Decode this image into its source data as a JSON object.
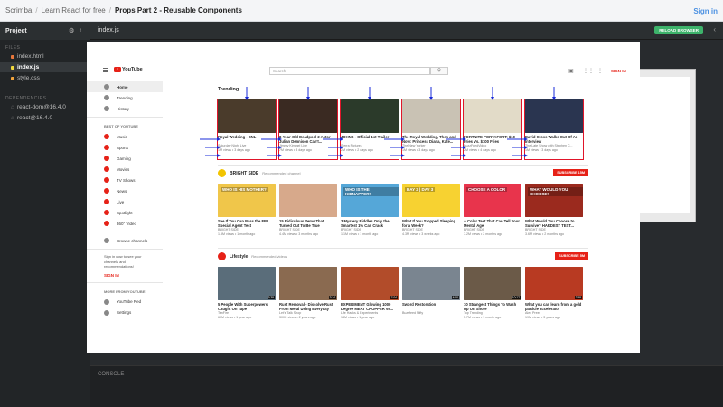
{
  "topbar": {
    "crumbs": [
      "Scrimba",
      "Learn React for free",
      "Props Part 2 - Reusable Components"
    ],
    "signin": "Sign in"
  },
  "sidebar": {
    "header": "Project",
    "files_label": "FILES",
    "files": [
      {
        "name": "index.html",
        "color": "#e8773b"
      },
      {
        "name": "index.js",
        "color": "#f1d83d",
        "active": true
      },
      {
        "name": "style.css",
        "color": "#f0a23b"
      }
    ],
    "deps_label": "DEPENDENCIES",
    "deps": [
      "react-dom@16.4.0",
      "react@16.4.0"
    ]
  },
  "editor": {
    "tab": "index.js",
    "reload": "RELOAD BROWSER",
    "console": "CONSOLE"
  },
  "yt": {
    "logo": "YouTube",
    "search_placeholder": "Search",
    "signin": "SIGN IN",
    "side": {
      "main": [
        "Home",
        "Trending",
        "History"
      ],
      "best_label": "BEST OF YOUTUBE",
      "best": [
        "Music",
        "Sports",
        "Gaming",
        "Movies",
        "TV Shows",
        "News",
        "Live",
        "Spotlight",
        "360° Video"
      ],
      "browse": "Browse channels",
      "note": "Sign in now to see your channels and recommendations!",
      "signin": "SIGN IN",
      "more_label": "MORE FROM YOUTUBE",
      "more": [
        "YouTube Red",
        "Settings"
      ]
    },
    "trending": {
      "title": "Trending",
      "cards": [
        {
          "title": "Royal Wedding - SNL",
          "channel": "Saturday Night Live",
          "meta": "1M views • 3 days ago",
          "bg": "#4a3b2b"
        },
        {
          "title": "8-Year-Old Deadpool 2 Actor Julian Dennison Can't...",
          "channel": "Jimmy Kimmel Live",
          "meta": "7M views • 3 days ago",
          "bg": "#3a2a22"
        },
        {
          "title": "JOHNS - Official 1st Trailer",
          "channel": "Sierra Pictures",
          "meta": "2M views • 2 days ago",
          "bg": "#2b3a2a"
        },
        {
          "title": "The Royal Wedding, Then and Now: Princess Diana, Kate...",
          "channel": "The New Yorker",
          "meta": "1M views • 3 days ago",
          "bg": "#c9c2b4"
        },
        {
          "title": "FORTNITE PORTAFORT: $10 Fries Vs. $100 Fries",
          "channel": "BuzzFeedVideo",
          "meta": "2M views • 4 days ago",
          "bg": "#e2dbc8"
        },
        {
          "title": "David Cross Walks Out Of An Interview",
          "channel": "The Late Show with Stephen C...",
          "meta": "1M views • 3 days ago",
          "bg": "#2a3550"
        }
      ]
    },
    "bright": {
      "name": "BRIGHT SIDE",
      "sub": "Recommended channel",
      "subscribe": "SUBSCRIBE 15M",
      "cards": [
        {
          "title": "See If You Can Pass the FBI Special Agent Test",
          "channel": "BRIGHT SIDE",
          "meta": "1.5M views • 1 month ago",
          "bg": "#f0c64a",
          "label": "WHO IS HIS MOTHER?"
        },
        {
          "title": "15 Ridiculous Items That Turned Out To Be True",
          "channel": "BRIGHT SIDE",
          "meta": "4.4M views • 3 months ago",
          "bg": "#d7a98b",
          "label": ""
        },
        {
          "title": "3 Mystery Riddles Only the Smartest 1% Can Crack",
          "channel": "BRIGHT SIDE",
          "meta": "1.1M views • 1 month ago",
          "bg": "#55a7d8",
          "label": "WHO IS THE KIDNAPPER?"
        },
        {
          "title": "What If You Stopped Sleeping for a Week?",
          "channel": "BRIGHT SIDE",
          "meta": "4.3M views • 3 weeks ago",
          "bg": "#f7d231",
          "label": "DAY 2 | DAY 3"
        },
        {
          "title": "A Color Test That Can Tell Your Mental Age",
          "channel": "BRIGHT SIDE",
          "meta": "7.2M views • 2 months ago",
          "bg": "#e8344c",
          "label": "CHOOSE A COLOR"
        },
        {
          "title": "What Would You Choose to Survive? HARDEST TEST...",
          "channel": "BRIGHT SIDE",
          "meta": "3.6M views • 2 months ago",
          "bg": "#9b2a1e",
          "label": "WHAT WOULD YOU CHOOSE?"
        }
      ]
    },
    "lifestyle": {
      "name": "Lifestyle",
      "sub": "Recommended videos",
      "subscribe": "SUBSCRIBE 5M",
      "cards": [
        {
          "title": "5 People With Superpowers Caught On Tape",
          "channel": "TenFire",
          "meta": "60M views • 1 year ago",
          "bg": "#5a6d7a",
          "dur": "3:38"
        },
        {
          "title": "Rust Removal - Dissolve Rust From Metal Using Everyday Bra...",
          "channel": "Let's Talk Shop",
          "meta": "300K views • 2 years ago",
          "bg": "#8a6a50",
          "dur": "3:24"
        },
        {
          "title": "EXPERIMENT Glowing 1000 Degree MEAT CHOPPER vs...",
          "channel": "Life Hacks & Experiments",
          "meta": "14M views • 1 year ago",
          "bg": "#b24c2a",
          "dur": "7:04"
        },
        {
          "title": "Sword Restoration",
          "channel": "Buzzfeed Nifty",
          "meta": "",
          "bg": "#7a8590",
          "dur": "4:10"
        },
        {
          "title": "10 Strangest Things To Wash Up On Shore",
          "channel": "Top Trending",
          "meta": "5.7M views • 1 month ago",
          "bg": "#6b5a48",
          "dur": "10:17"
        },
        {
          "title": "What you can learn from a gold particle accelerator",
          "channel": "Alex Preer",
          "meta": "19M views • 3 years ago",
          "bg": "#b83a22",
          "dur": "2:58"
        }
      ]
    }
  }
}
